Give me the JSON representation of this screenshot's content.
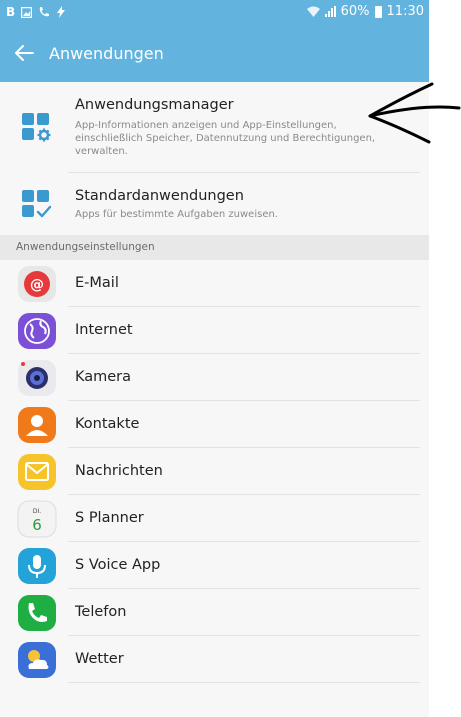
{
  "status_bar": {
    "left_text": "B",
    "battery": "60%",
    "time": "11:30"
  },
  "app_bar": {
    "title": "Anwendungen"
  },
  "manager": {
    "title": "Anwendungsmanager",
    "subtitle": "App-Informationen anzeigen und App-Einstellungen, einschließlich Speicher, Datennutzung und Berechtigungen, verwalten."
  },
  "defaults": {
    "title": "Standardanwendungen",
    "subtitle": "Apps für bestimmte Aufgaben zuweisen."
  },
  "section": {
    "label": "Anwendungseinstellungen"
  },
  "apps": [
    {
      "label": "E-Mail",
      "icon": "email-icon"
    },
    {
      "label": "Internet",
      "icon": "internet-icon"
    },
    {
      "label": "Kamera",
      "icon": "camera-icon"
    },
    {
      "label": "Kontakte",
      "icon": "contacts-icon"
    },
    {
      "label": "Nachrichten",
      "icon": "messages-icon"
    },
    {
      "label": "S Planner",
      "icon": "calendar-icon",
      "day": "DI.",
      "date": "6"
    },
    {
      "label": "S Voice App",
      "icon": "microphone-icon"
    },
    {
      "label": "Telefon",
      "icon": "phone-icon"
    },
    {
      "label": "Wetter",
      "icon": "weather-icon"
    }
  ]
}
